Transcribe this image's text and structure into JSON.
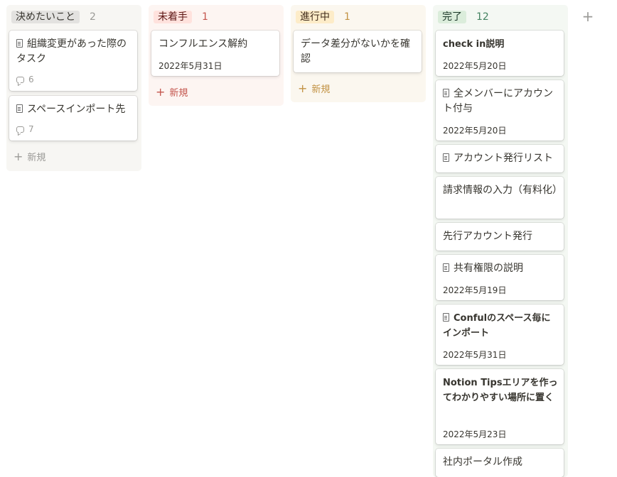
{
  "columns": [
    {
      "title": "決めたいこと",
      "count": "2",
      "new_label": "新規",
      "cards": [
        {
          "title": "組織変更があった際のタスク",
          "comments": "6"
        },
        {
          "title": "スペースインポート先",
          "comments": "7"
        }
      ]
    },
    {
      "title": "未着手",
      "count": "1",
      "new_label": "新規",
      "cards": [
        {
          "title": "コンフルエンス解約",
          "date": "2022年5月31日"
        }
      ]
    },
    {
      "title": "進行中",
      "count": "1",
      "new_label": "新規",
      "cards": [
        {
          "title": "データ差分がないかを確認"
        }
      ]
    },
    {
      "title": "完了",
      "count": "12",
      "cards": [
        {
          "title": "check in説明",
          "date": "2022年5月20日"
        },
        {
          "title": "全メンバーにアカウント付与",
          "date": "2022年5月20日"
        },
        {
          "title": "アカウント発行リスト"
        },
        {
          "title": "請求情報の入力（有料化）"
        },
        {
          "title": "先行アカウント発行"
        },
        {
          "title": "共有権限の説明",
          "date": "2022年5月19日"
        },
        {
          "title": "Confulのスペース毎にインポート",
          "date": "2022年5月31日"
        },
        {
          "title": "Notion Tipsエリアを作ってわかりやすい場所に置く",
          "date": "2022年5月23日"
        },
        {
          "title": "社内ポータル作成"
        }
      ]
    }
  ],
  "add_column_label": "+",
  "colors": {
    "gray_bg": "#f7f6f3",
    "gray_pill": "#e3e2e0",
    "red_bg": "#fdf5f2",
    "red_pill": "#ffe2dd",
    "red_text": "#c4554d",
    "yellow_bg": "#fbf7ef",
    "yellow_pill": "#fdecc8",
    "yellow_text": "#c29243",
    "green_bg": "#f4f8f3",
    "green_pill": "#dbeddb",
    "green_text": "#448361"
  }
}
